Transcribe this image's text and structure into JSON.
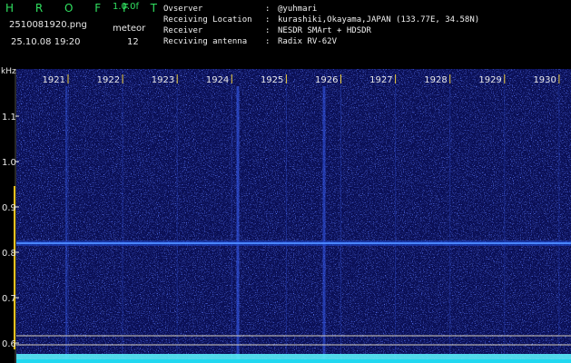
{
  "app": {
    "title": "H R O F F T",
    "version": "1.0.0f"
  },
  "capture": {
    "file_name": "2510081920.png",
    "mode_label": "meteor",
    "datetime": "25.10.08 19:20",
    "count": "12"
  },
  "info": {
    "rows": [
      {
        "label": "Ovserver",
        "sep": ":",
        "value": "@yuhmari"
      },
      {
        "label": "Receiving Location",
        "sep": ":",
        "value": "kurashiki,Okayama,JAPAN (133.77E, 34.58N)"
      },
      {
        "label": "Receiver",
        "sep": ":",
        "value": "NESDR SMArt + HDSDR"
      },
      {
        "label": "Recviving antenna",
        "sep": ":",
        "value": "Radix RV-62V"
      }
    ]
  },
  "y_axis": {
    "unit": "kHz",
    "ticks": [
      "1.1",
      "1.0",
      "0.9",
      "0.8",
      "0.7",
      "0.6"
    ]
  },
  "x_axis": {
    "ticks": [
      "1921",
      "1922",
      "1923",
      "1924",
      "1925",
      "1926",
      "1927",
      "1928",
      "1929",
      "1930"
    ]
  },
  "colors": {
    "background": "#000000",
    "waterfall_base": "#0a0f55",
    "signal_line": "#2a6cff",
    "noise_bar": "#20d8f0",
    "title_green": "#30e060"
  }
}
